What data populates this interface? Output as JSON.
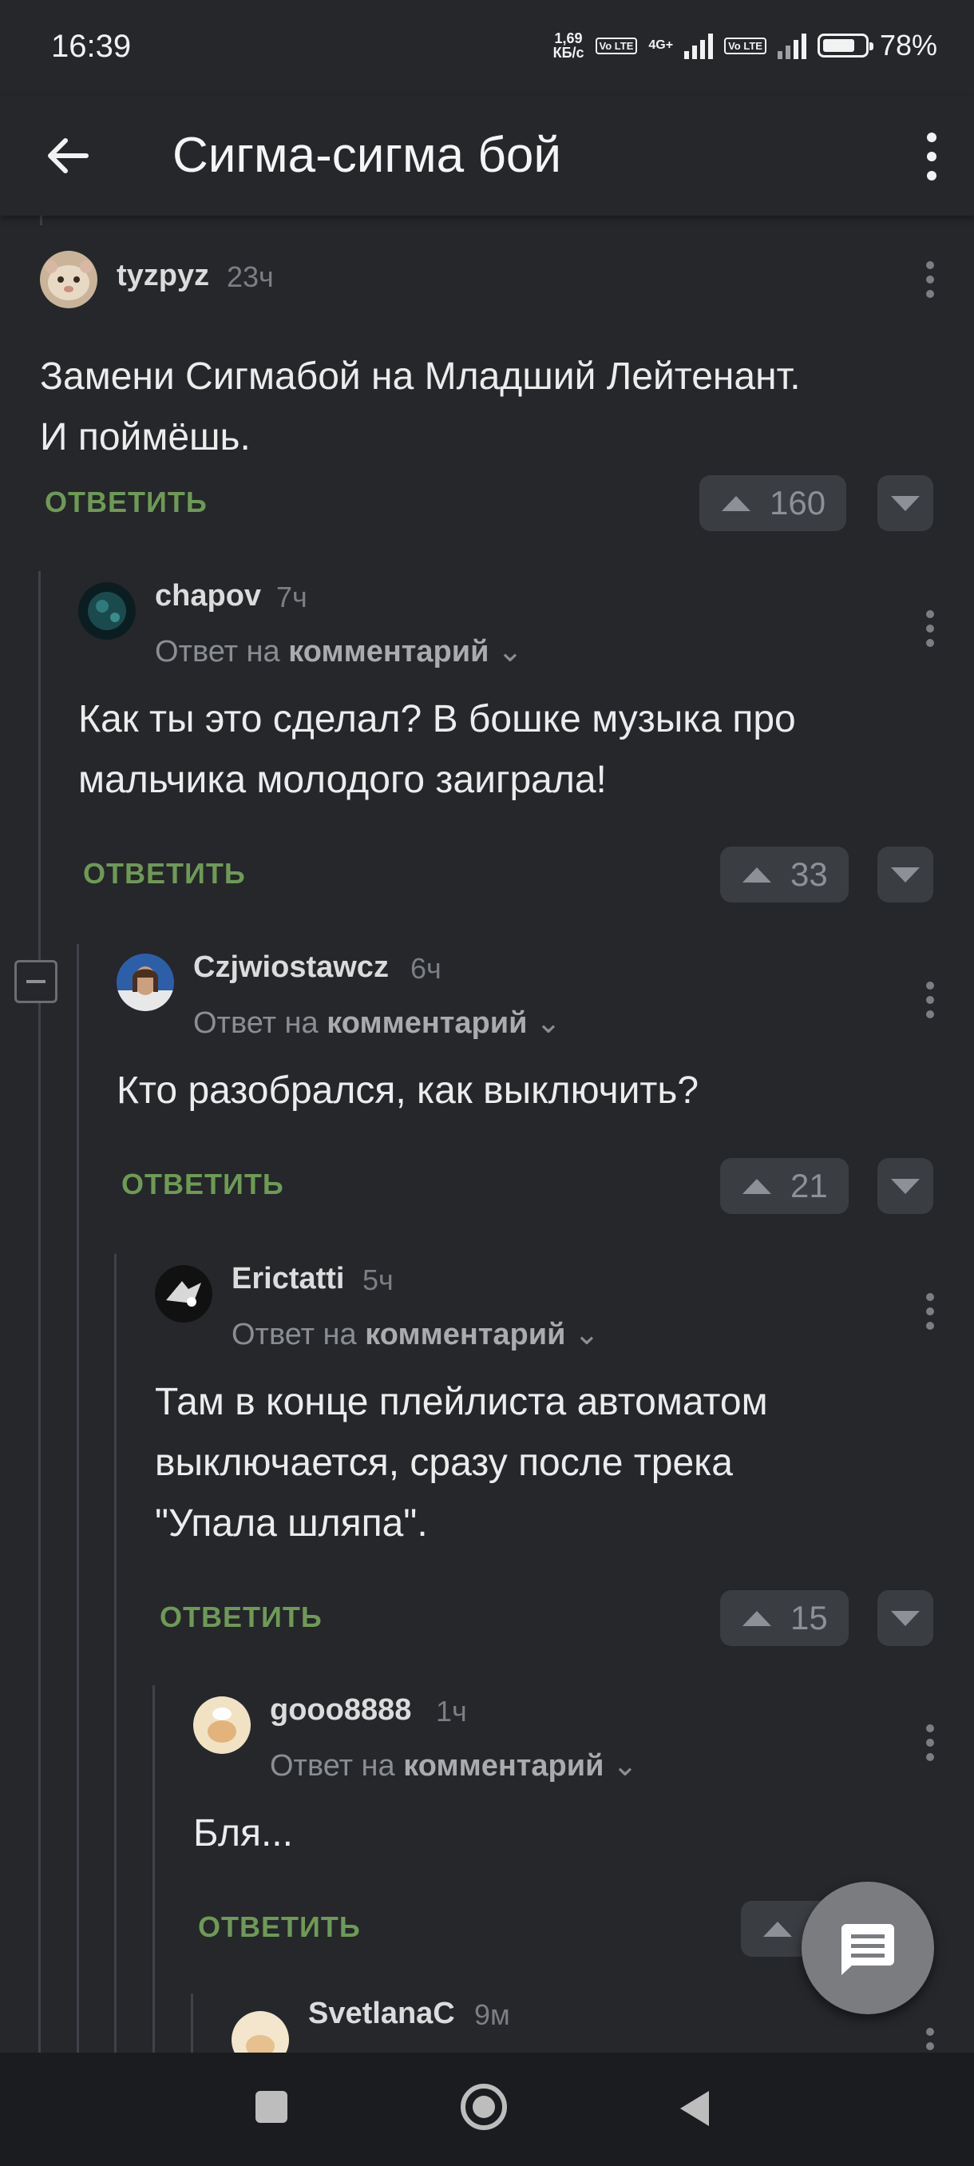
{
  "status_bar": {
    "time": "16:39",
    "speed_value": "1,69",
    "speed_unit": "КБ/с",
    "lte_chip": "Vo LTE",
    "net_type": "4G+",
    "battery": "78%",
    "battery_level": 0.78
  },
  "app_bar": {
    "title": "Сигма-сигма бой"
  },
  "reply_prefix": "Ответ на",
  "reply_target": "комментарий",
  "reply_label": "ОТВЕТИТЬ",
  "comments": [
    {
      "user": "tyzpyz",
      "time": "23ч",
      "text": "Замени Сигмабой на Младший Лейтенант.\nИ поймёшь.",
      "votes": "160",
      "avatar_color": "#d8c9b4"
    },
    {
      "user": "chapov",
      "time": "7ч",
      "text": "Как ты это сделал? В бошке музыка про\nмальчика молодого заиграла!",
      "votes": "33",
      "avatar_color": "#113538"
    },
    {
      "user": "Czjwiostawcz",
      "time": "6ч",
      "text": "Кто разобрался, как выключить?",
      "votes": "21",
      "avatar_color": "#2d5fa8"
    },
    {
      "user": "Erictatti",
      "time": "5ч",
      "text": "Там в конце плейлиста автоматом\nвыключается, сразу после трека\n\"Упала шляпа\".",
      "votes": "15",
      "avatar_color": "#1a1a1a"
    },
    {
      "user": "gooo8888",
      "time": "1ч",
      "text": "Бля...",
      "votes": "",
      "avatar_color": "#f1e2c4"
    },
    {
      "user": "SvetlanaC",
      "time": "9м",
      "text": "",
      "votes": "",
      "avatar_color": "#f3e6cc"
    }
  ],
  "colors": {
    "background": "#25272b",
    "reply_green": "#6e9a55",
    "vote_bg": "#3a3d42",
    "fab": "#7a7c80"
  }
}
